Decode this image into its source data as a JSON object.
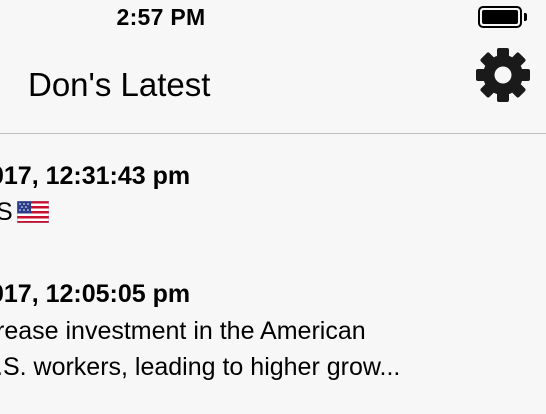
{
  "status_bar": {
    "time": "2:57 PM",
    "battery_icon": "battery-full-icon"
  },
  "nav": {
    "title": "Don's Latest",
    "settings_icon": "gear-icon"
  },
  "feed": {
    "items": [
      {
        "date": "017, 12:31:43 pm",
        "lines": [
          "S"
        ],
        "trailing_icon": "us-flag-emoji"
      },
      {
        "date": "017, 12:05:05 pm",
        "lines": [
          "rease investment in the American",
          ".S. workers, leading to higher grow..."
        ]
      }
    ]
  },
  "colors": {
    "background": "#f7f7f7",
    "divider": "#bdbdbd",
    "text": "#000000",
    "icon": "#1a1a1a"
  }
}
